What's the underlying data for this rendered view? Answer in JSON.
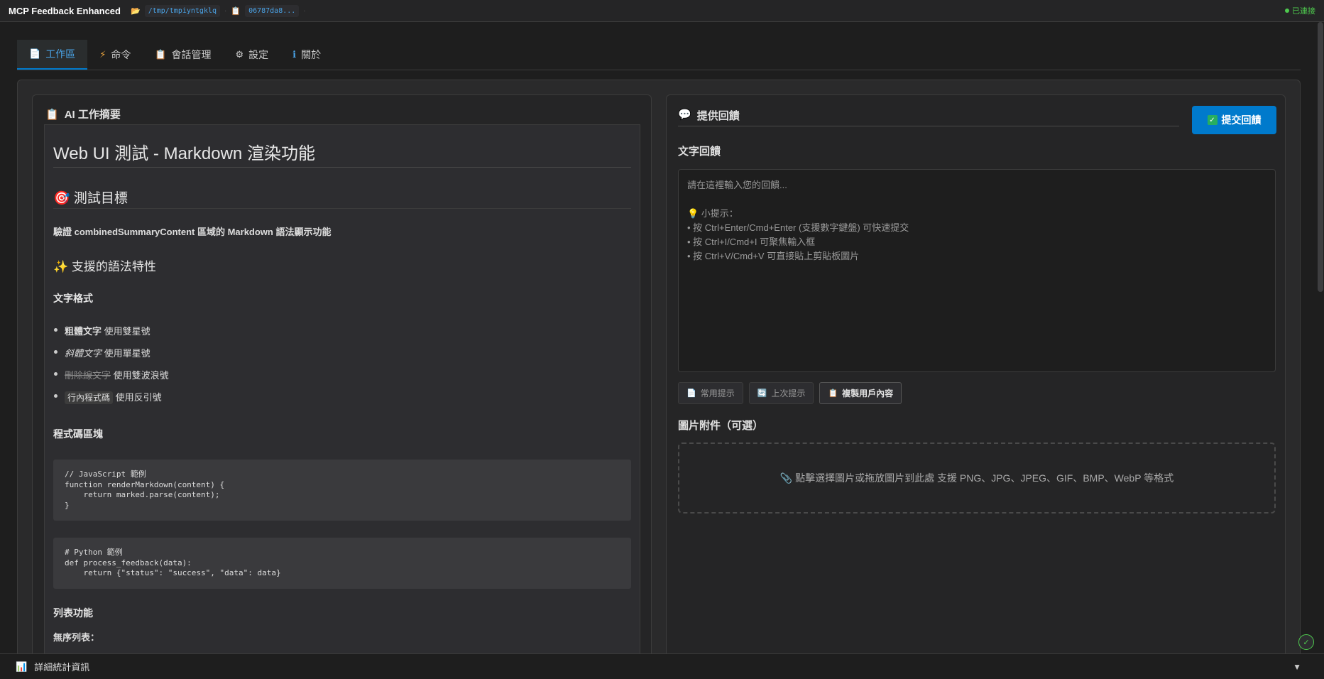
{
  "header": {
    "title": "MCP Feedback Enhanced",
    "project_icon": "folder-icon",
    "project_path": "/tmp/tmpiyntgklq",
    "session_icon": "clipboard-icon",
    "session_id": "06787da8...",
    "status": "已連接",
    "status_color": "#4ec94e"
  },
  "tabs": [
    {
      "label": "工作區",
      "icon": "📄",
      "active": true
    },
    {
      "label": "命令",
      "icon": "⚡"
    },
    {
      "label": "會話管理",
      "icon": "📋"
    },
    {
      "label": "設定",
      "icon": "⚙"
    },
    {
      "label": "關於",
      "icon": "ℹ"
    }
  ],
  "summary": {
    "title": "AI 工作摘要",
    "icon": "📋",
    "h1": "Web UI 測試 - Markdown 渲染功能",
    "h2_goal": "🎯 測試目標",
    "goal_text": "驗證 combinedSummaryContent 區域的 Markdown 語法顯示功能",
    "h3_features": "✨ 支援的語法特性",
    "h4_text_format": "文字格式",
    "format_items": [
      {
        "styled": "粗體文字",
        "rest": " 使用雙星號"
      },
      {
        "styled": "斜體文字",
        "rest": " 使用單星號"
      },
      {
        "styled": "刪除線文字",
        "rest": " 使用雙波浪號"
      },
      {
        "styled": "行內程式碼",
        "rest": " 使用反引號"
      }
    ],
    "h4_code_block": "程式碼區塊",
    "code_js": [
      "// JavaScript 範例",
      "function renderMarkdown(content) {",
      "    return marked.parse(content);",
      "}"
    ],
    "code_py": [
      "# Python 範例",
      "def process_feedback(data):",
      "    return {\"status\": \"success\", \"data\": data}"
    ],
    "h4_list": "列表功能",
    "unordered_list_label": "無序列表："
  },
  "feedback": {
    "title": "提供回饋",
    "icon": "💬",
    "submit_label": "提交回饋",
    "text_label": "文字回饋",
    "placeholder": "請在這裡輸入您的回饋...\n\n💡 小提示：\n• 按 Ctrl+Enter/Cmd+Enter (支援數字鍵盤) 可快速提交\n• 按 Ctrl+I/Cmd+I 可聚焦輸入框\n• 按 Ctrl+V/Cmd+V 可直接貼上剪貼板圖片",
    "buttons": [
      {
        "label": "常用提示",
        "icon": "📄"
      },
      {
        "label": "上次提示",
        "icon": "🔄"
      },
      {
        "label": "複製用戶內容",
        "icon": "📋"
      }
    ],
    "image_label": "圖片附件（可選）",
    "dropzone_text": "📎 點擊選擇圖片或拖放圖片到此處 支援 PNG、JPG、JPEG、GIF、BMP、WebP 等格式"
  },
  "footer": {
    "label": "詳細統計資訊",
    "icon": "📊"
  }
}
